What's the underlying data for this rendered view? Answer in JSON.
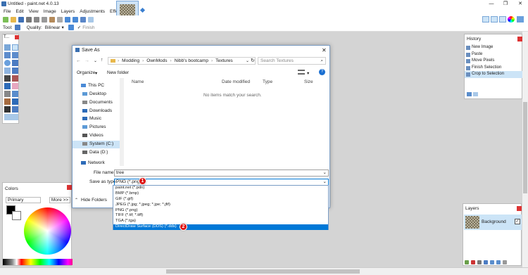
{
  "window": {
    "title": "Untitled - paint.net 4.0.13",
    "controls": [
      "—",
      "❐",
      "✕"
    ]
  },
  "menu": [
    "File",
    "Edit",
    "View",
    "Image",
    "Layers",
    "Adjustments",
    "Effects"
  ],
  "toolbar": {
    "tool_label": "Tool:",
    "quality_label": "Quality:",
    "quality_value": "Bilinear",
    "finish_label": "Finish"
  },
  "tools_panel": {
    "title": "T..."
  },
  "history": {
    "title": "History",
    "items": [
      "New Image",
      "Paste",
      "Move Pixels",
      "Finish Selection",
      "Crop to Selection"
    ],
    "selected_index": 4
  },
  "colors_panel": {
    "title": "Colors",
    "mode": "Primary",
    "more_button": "More >>"
  },
  "layers_panel": {
    "title": "Layers",
    "layer_name": "Background"
  },
  "dialog": {
    "title": "Save As",
    "breadcrumb": [
      "Modding",
      "OwnMods",
      "Nibb's bootcamp",
      "Textures"
    ],
    "search_placeholder": "Search Textures",
    "organize": "Organize",
    "new_folder": "New folder",
    "nav_items": [
      "This PC",
      "Desktop",
      "Documents",
      "Downloads",
      "Music",
      "Pictures",
      "Videos",
      "System (C:)",
      "Data (D:)",
      "Network"
    ],
    "nav_selected_index": 7,
    "columns": [
      "Name",
      "Date modified",
      "Type",
      "Size"
    ],
    "empty_message": "No items match your search.",
    "file_name_label": "File name:",
    "file_name_value": "tree",
    "save_type_label": "Save as type:",
    "save_type_value": "PNG (*.png)",
    "hide_folders": "Hide Folders",
    "file_types": [
      "paint.net (*.pdn)",
      "BMP (*.bmp)",
      "GIF (*.gif)",
      "JPEG (*.jpg; *.jpeg; *.jpe; *.jfif)",
      "PNG (*.png)",
      "TIFF (*.tif; *.tiff)",
      "TGA (*.tga)",
      "DirectDraw Surface (DDS) (*.dds)"
    ],
    "file_type_selected_index": 7,
    "close": "✕"
  },
  "badges": {
    "first": "1",
    "second": "2"
  },
  "colors": {
    "accent": "#0078d7",
    "badge": "#d11111",
    "selection": "#cce4f7"
  }
}
